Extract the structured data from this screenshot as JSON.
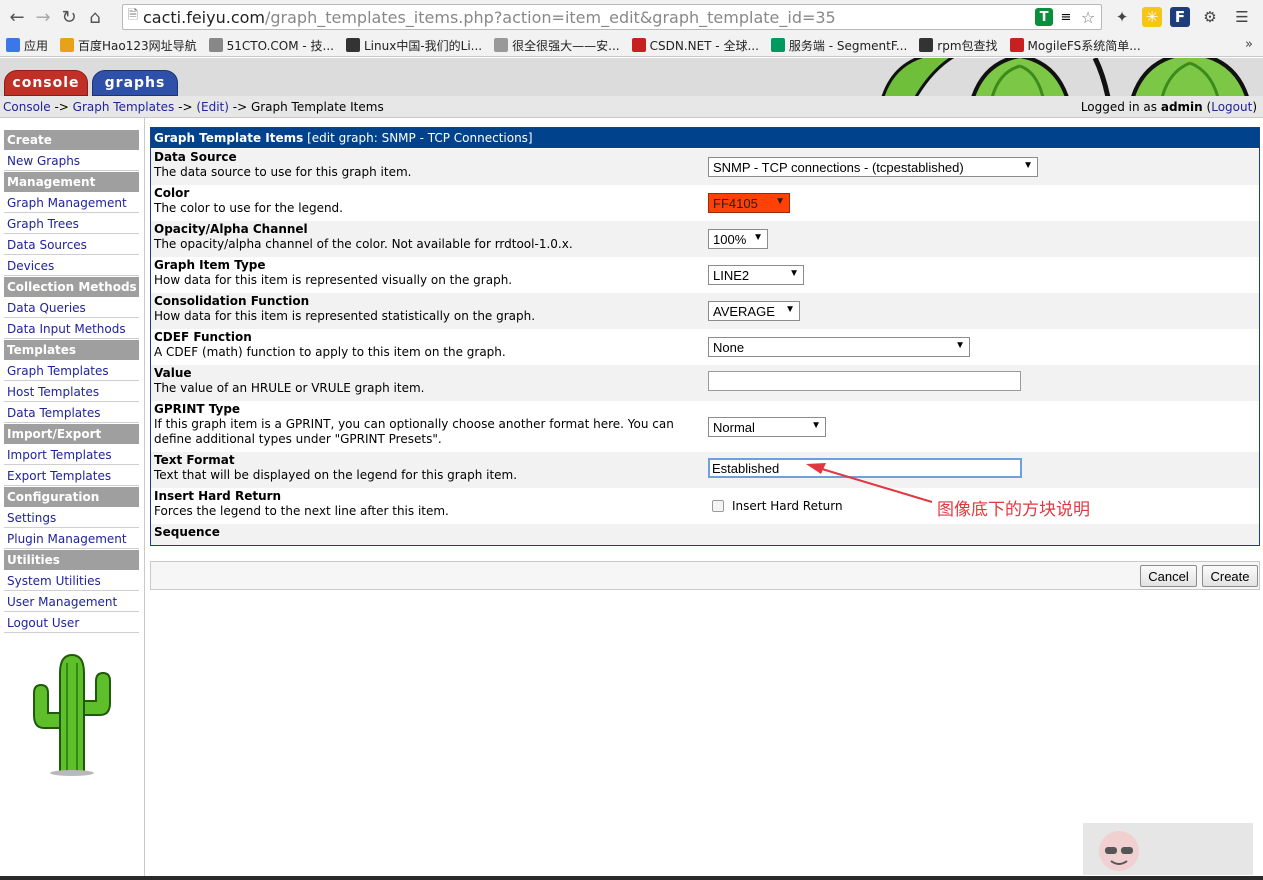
{
  "browser": {
    "url_host": "cacti.feiyu.com",
    "url_path": "/graph_templates_items.php?action=item_edit&graph_template_id=35",
    "bookmarks": [
      {
        "label": "应用",
        "icon": "apps-grid-icon",
        "color": "#3b78e7"
      },
      {
        "label": "百度Hao123网址导航",
        "icon": "hao123-icon",
        "color": "#e8a21a"
      },
      {
        "label": "51CTO.COM - 技...",
        "icon": "51cto-icon",
        "color": "#888888"
      },
      {
        "label": "Linux中国-我们的Li...",
        "icon": "linux-cn-icon",
        "color": "#333333"
      },
      {
        "label": "很全很强大——安...",
        "icon": "page-icon",
        "color": "#999999"
      },
      {
        "label": "CSDN.NET - 全球...",
        "icon": "csdn-icon",
        "color": "#c8201e"
      },
      {
        "label": "服务端 - SegmentF...",
        "icon": "segmentfault-icon",
        "color": "#009a61"
      },
      {
        "label": "rpm包查找",
        "icon": "search-icon",
        "color": "#333333"
      },
      {
        "label": "MogileFS系统简单...",
        "icon": "shield-icon",
        "color": "#c8201e"
      }
    ],
    "more": "»"
  },
  "tabs": {
    "console": "console",
    "graphs": "graphs"
  },
  "breadcrumb": {
    "console": "Console",
    "sep1": " -> ",
    "graph_templates": "Graph Templates",
    "sep2": " -> ",
    "edit": "(Edit)",
    "sep3": " -> ",
    "current": "Graph Template Items"
  },
  "login": {
    "prefix": "Logged in as ",
    "user": "admin",
    "open": " (",
    "logout": "Logout",
    "close": ")"
  },
  "sidebar": {
    "sections": [
      {
        "title": "Create",
        "items": [
          "New Graphs"
        ]
      },
      {
        "title": "Management",
        "items": [
          "Graph Management",
          "Graph Trees",
          "Data Sources",
          "Devices"
        ]
      },
      {
        "title": "Collection Methods",
        "items": [
          "Data Queries",
          "Data Input Methods"
        ]
      },
      {
        "title": "Templates",
        "items": [
          "Graph Templates",
          "Host Templates",
          "Data Templates"
        ]
      },
      {
        "title": "Import/Export",
        "items": [
          "Import Templates",
          "Export Templates"
        ]
      },
      {
        "title": "Configuration",
        "items": [
          "Settings",
          "Plugin Management"
        ]
      },
      {
        "title": "Utilities",
        "items": [
          "System Utilities",
          "User Management",
          "Logout User"
        ]
      }
    ]
  },
  "form": {
    "title_bold": "Graph Template Items",
    "title_rest": " [edit graph: SNMP - TCP Connections]",
    "rows": [
      {
        "title": "Data Source",
        "desc": "The data source to use for this graph item.",
        "value": "SNMP - TCP connections - (tcpestablished)"
      },
      {
        "title": "Color",
        "desc": "The color to use for the legend.",
        "value": "FF4105"
      },
      {
        "title": "Opacity/Alpha Channel",
        "desc": "The opacity/alpha channel of the color. Not available for rrdtool-1.0.x.",
        "value": "100%"
      },
      {
        "title": "Graph Item Type",
        "desc": "How data for this item is represented visually on the graph.",
        "value": "LINE2"
      },
      {
        "title": "Consolidation Function",
        "desc": "How data for this item is represented statistically on the graph.",
        "value": "AVERAGE"
      },
      {
        "title": "CDEF Function",
        "desc": "A CDEF (math) function to apply to this item on the graph.",
        "value": "None"
      },
      {
        "title": "Value",
        "desc": "The value of an HRULE or VRULE graph item.",
        "value": ""
      },
      {
        "title": "GPRINT Type",
        "desc": "If this graph item is a GPRINT, you can optionally choose another format here. You can define additional types under \"GPRINT Presets\".",
        "value": "Normal"
      },
      {
        "title": "Text Format",
        "desc": "Text that will be displayed on the legend for this graph item.",
        "value": "Established"
      },
      {
        "title": "Insert Hard Return",
        "desc": "Forces the legend to the next line after this item.",
        "value": "Insert Hard Return"
      },
      {
        "title": "Sequence",
        "desc": "",
        "value": ""
      }
    ]
  },
  "annotation": "图像底下的方块说明",
  "buttons": {
    "cancel": "Cancel",
    "create": "Create"
  },
  "colors": {
    "header_blue": "#00438c",
    "console_tab": "#c03026",
    "graphs_tab": "#2f50a8",
    "link": "#20239c",
    "legend_color": "#ff4105",
    "annotation_red": "#e0383f"
  }
}
